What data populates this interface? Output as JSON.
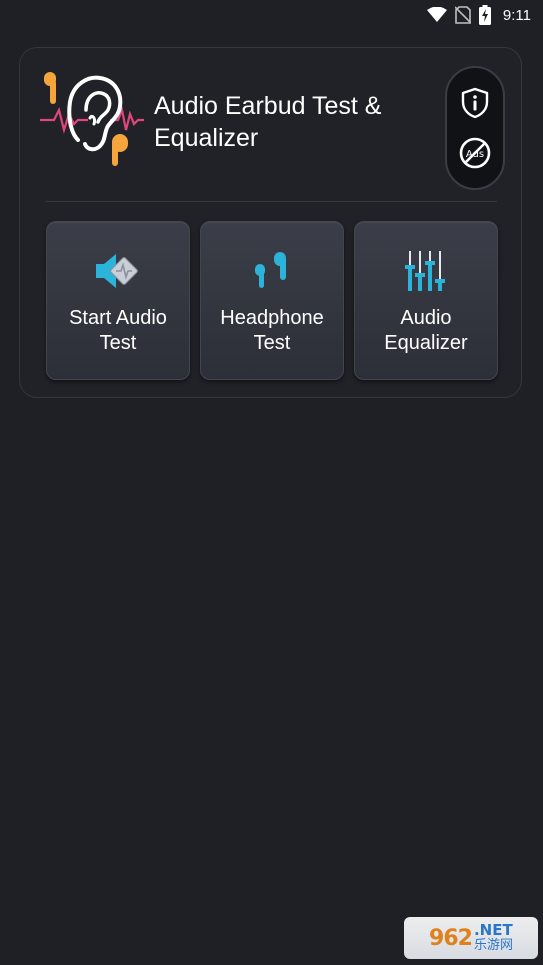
{
  "status_bar": {
    "time": "9:11",
    "icons": [
      "wifi-icon",
      "no-sim-icon",
      "battery-charging-icon"
    ]
  },
  "header": {
    "title": "Audio Earbud Test & Equalizer",
    "logo_icon": "ear-earbuds-logo-icon",
    "actions": [
      {
        "name": "privacy-shield-button",
        "icon": "shield-info-icon"
      },
      {
        "name": "remove-ads-button",
        "icon": "no-ads-icon",
        "label": "Ads"
      }
    ]
  },
  "tiles": [
    {
      "label": "Start Audio\nTest",
      "icon": "speaker-icon"
    },
    {
      "label": "Headphone\nTest",
      "icon": "earbuds-icon"
    },
    {
      "label": "Audio\nEqualizer",
      "icon": "equalizer-icon"
    }
  ],
  "watermark": {
    "brand": "962",
    "suffix": ".NET",
    "sub": "乐游网"
  },
  "colors": {
    "background": "#1e2025",
    "card": "#202228",
    "accent_teal": "#2bb3d9",
    "accent_orange": "#f5a53c",
    "accent_pink": "#e0457b"
  }
}
